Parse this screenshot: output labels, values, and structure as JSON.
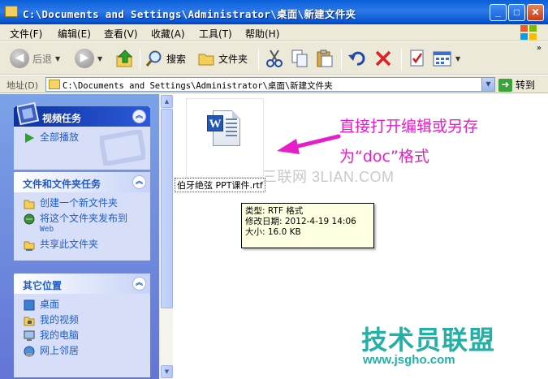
{
  "window": {
    "title": "C:\\Documents and Settings\\Administrator\\桌面\\新建文件夹",
    "buttons": {
      "minimize": "_",
      "maximize": "□",
      "close": "✕"
    }
  },
  "menu": [
    "文件(F)",
    "编辑(E)",
    "查看(V)",
    "收藏(A)",
    "工具(T)",
    "帮助(H)"
  ],
  "toolbar": {
    "back": "后退",
    "search": "搜索",
    "folders": "文件夹"
  },
  "address": {
    "label": "地址(D)",
    "path": "C:\\Documents and Settings\\Administrator\\桌面\\新建文件夹",
    "go": "转到"
  },
  "left_panels": {
    "video_tasks": {
      "title": "视频任务",
      "items": [
        "全部播放"
      ]
    },
    "file_tasks": {
      "title": "文件和文件夹任务",
      "items": [
        {
          "label": "创建一个新文件夹"
        },
        {
          "label": "将这个文件夹发布到",
          "sub": "Web"
        },
        {
          "label": "共享此文件夹"
        }
      ]
    },
    "other_places": {
      "title": "其它位置",
      "items": [
        "桌面",
        "我的视频",
        "我的电脑",
        "网上邻居"
      ]
    }
  },
  "file": {
    "name": "伯牙绝弦 PPT课件.rtf",
    "tooltip": {
      "type": "类型: RTF 格式",
      "modified": "修改日期: 2012-4-19 14:06",
      "size": "大小: 16.0 KB"
    }
  },
  "annotation": {
    "line1": "直接打开编辑或另存",
    "line2": "为“doc”格式"
  },
  "watermarks": {
    "top": "三联网 3LIAN.COM",
    "brand": "技术员联盟",
    "url": "www.jsgho.com"
  },
  "colors": {
    "titlebar": "#0a5fd8",
    "sidebar": "#6f8de0",
    "annotation": "#e61ec8",
    "watermark": "#23b0a6"
  }
}
